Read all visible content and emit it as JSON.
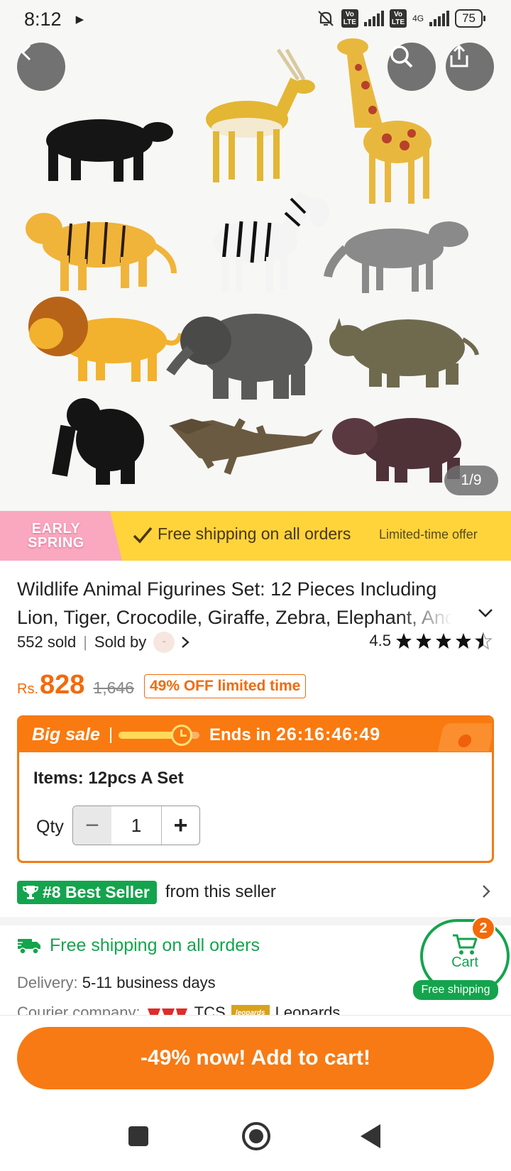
{
  "status_bar": {
    "time": "8:12",
    "network": "4G",
    "battery": "75"
  },
  "gallery": {
    "counter": "1/9",
    "animals": [
      "bear",
      "antelope",
      "giraffe",
      "tiger",
      "zebra",
      "wolf",
      "lion",
      "elephant",
      "rhino",
      "gorilla",
      "crocodile",
      "hippo"
    ]
  },
  "promo": {
    "badge_line1": "EARLY",
    "badge_line2": "SPRING",
    "main": "Free shipping on all orders",
    "side": "Limited-time offer"
  },
  "product": {
    "title": "Wildlife Animal Figurines Set: 12 Pieces Including Lion, Tiger, Crocodile, Giraffe, Zebra, Elephant, And More",
    "sold": "552 sold",
    "sold_by": "Sold by",
    "rating": "4.5",
    "stars": 4.5
  },
  "price": {
    "currency": "Rs.",
    "current": "828",
    "original": "1,646",
    "discount": "49% OFF limited time"
  },
  "sale": {
    "label": "Big sale",
    "ends_label": "Ends in",
    "countdown": "26:16:46:49",
    "progress": 0.72,
    "items_label": "Items: 12pcs A Set",
    "qty_label": "Qty",
    "qty_value": "1",
    "minus": "−",
    "plus": "+"
  },
  "best_seller": {
    "badge": "#8 Best Seller",
    "text": "from this seller"
  },
  "shipping": {
    "title": "Free shipping on all orders",
    "delivery_key": "Delivery:",
    "delivery_value": "5-11 business days",
    "courier_key": "Courier company:",
    "courier_1": "TCS",
    "courier_2": "Leopards",
    "leopards_logo": "leopards"
  },
  "cart": {
    "count": "2",
    "label": "Cart",
    "ship": "Free shipping"
  },
  "cta": {
    "label": "-49% now! Add to cart!"
  },
  "colors": {
    "accent": "#f77a14",
    "green": "#14a44d",
    "promo_yellow": "#ffd43b"
  }
}
